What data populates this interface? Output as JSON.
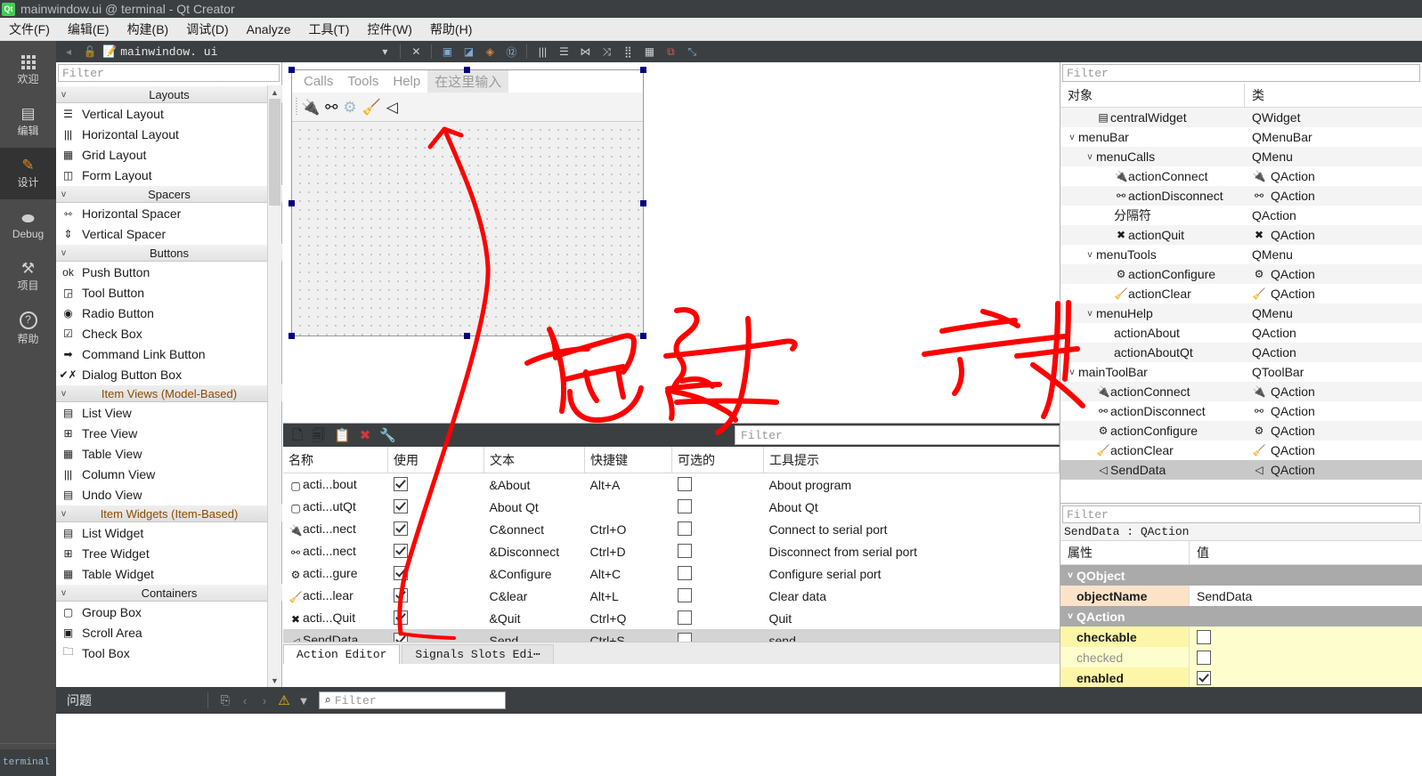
{
  "window": {
    "title": "mainwindow.ui @ terminal - Qt Creator",
    "logo": "qt-logo"
  },
  "menubar": {
    "items": [
      {
        "label": "文件(F)"
      },
      {
        "label": "编辑(E)"
      },
      {
        "label": "构建(B)"
      },
      {
        "label": "调试(D)"
      },
      {
        "label": "Analyze"
      },
      {
        "label": "工具(T)"
      },
      {
        "label": "控件(W)"
      },
      {
        "label": "帮助(H)"
      }
    ]
  },
  "modebar": {
    "items": [
      {
        "label": "欢迎",
        "icon": "grid-icon",
        "glyph": "",
        "active": false
      },
      {
        "label": "编辑",
        "icon": "document-icon",
        "glyph": "▤",
        "active": false
      },
      {
        "label": "设计",
        "icon": "pencil-icon",
        "glyph": "✎",
        "active": true
      },
      {
        "label": "Debug",
        "icon": "bug-icon",
        "glyph": "🐞",
        "active": false
      },
      {
        "label": "项目",
        "icon": "wrench-icon",
        "glyph": "🔧",
        "active": false
      },
      {
        "label": "帮助",
        "icon": "question-icon",
        "glyph": "?",
        "active": false
      }
    ],
    "taskbar_label": "terminal"
  },
  "editor_toolbar": {
    "filename": "mainwindow. ui",
    "lock_icon": "unlocked-padlock-icon",
    "file_icon": "ui-file-icon",
    "dropdown_icon": "chevron-down-icon",
    "close_icon": "close-icon",
    "buttons": [
      {
        "name": "adjust-size-button",
        "glyph": "▣"
      },
      {
        "name": "lay-out-break-button",
        "glyph": "◩"
      },
      {
        "name": "edit-signals-slots-button",
        "glyph": "◈"
      },
      {
        "name": "edit-tab-order-button",
        "glyph": "⑫"
      },
      {
        "name": "layout-horizontally-button",
        "glyph": "|||"
      },
      {
        "name": "layout-vertically-button",
        "glyph": "☰"
      },
      {
        "name": "layout-horizontal-splitter-button",
        "glyph": "⊦⊣"
      },
      {
        "name": "layout-vertical-splitter-button",
        "glyph": "⊼"
      },
      {
        "name": "layout-form-button",
        "glyph": "⠿"
      },
      {
        "name": "layout-grid-button",
        "glyph": "▦"
      },
      {
        "name": "break-layout-button",
        "glyph": "⧉"
      },
      {
        "name": "adjust-size-2-button",
        "glyph": "⤡"
      }
    ]
  },
  "widget_box": {
    "filter_placeholder": "Filter",
    "groups": [
      {
        "name": "Layouts",
        "selected": false,
        "items": [
          {
            "label": "Vertical Layout",
            "icon": "vertical-layout-icon",
            "glyph": "☰"
          },
          {
            "label": "Horizontal Layout",
            "icon": "horizontal-layout-icon",
            "glyph": "|||"
          },
          {
            "label": "Grid Layout",
            "icon": "grid-layout-icon",
            "glyph": "▦"
          },
          {
            "label": "Form Layout",
            "icon": "form-layout-icon",
            "glyph": "◫"
          }
        ]
      },
      {
        "name": "Spacers",
        "selected": false,
        "items": [
          {
            "label": "Horizontal Spacer",
            "icon": "horizontal-spacer-icon",
            "glyph": "⇿"
          },
          {
            "label": "Vertical Spacer",
            "icon": "vertical-spacer-icon",
            "glyph": "⇕"
          }
        ]
      },
      {
        "name": "Buttons",
        "selected": false,
        "items": [
          {
            "label": "Push Button",
            "icon": "push-button-icon",
            "glyph": "ok"
          },
          {
            "label": "Tool Button",
            "icon": "tool-button-icon",
            "glyph": "◲"
          },
          {
            "label": "Radio Button",
            "icon": "radio-button-icon",
            "glyph": "◉"
          },
          {
            "label": "Check Box",
            "icon": "check-box-icon",
            "glyph": "☑"
          },
          {
            "label": "Command Link Button",
            "icon": "command-link-button-icon",
            "glyph": "➡"
          },
          {
            "label": "Dialog Button Box",
            "icon": "dialog-button-box-icon",
            "glyph": "✔✗"
          }
        ]
      },
      {
        "name": "Item Views (Model-Based)",
        "selected": true,
        "items": [
          {
            "label": "List View",
            "icon": "list-view-icon",
            "glyph": "▤"
          },
          {
            "label": "Tree View",
            "icon": "tree-view-icon",
            "glyph": "⊞"
          },
          {
            "label": "Table View",
            "icon": "table-view-icon",
            "glyph": "▦"
          },
          {
            "label": "Column View",
            "icon": "column-view-icon",
            "glyph": "|||"
          },
          {
            "label": "Undo View",
            "icon": "undo-view-icon",
            "glyph": "▤"
          }
        ]
      },
      {
        "name": "Item Widgets (Item-Based)",
        "selected": true,
        "items": [
          {
            "label": "List Widget",
            "icon": "list-widget-icon",
            "glyph": "▤"
          },
          {
            "label": "Tree Widget",
            "icon": "tree-widget-icon",
            "glyph": "⊞"
          },
          {
            "label": "Table Widget",
            "icon": "table-widget-icon",
            "glyph": "▦"
          }
        ]
      },
      {
        "name": "Containers",
        "selected": false,
        "items": [
          {
            "label": "Group Box",
            "icon": "group-box-icon",
            "glyph": "▢"
          },
          {
            "label": "Scroll Area",
            "icon": "scroll-area-icon",
            "glyph": "▣"
          },
          {
            "label": "Tool Box",
            "icon": "tool-box-icon",
            "glyph": "🗀"
          }
        ]
      }
    ]
  },
  "form": {
    "menu_items": [
      "Calls",
      "Tools",
      "Help"
    ],
    "type_here": "在这里输入",
    "toolbar_icons": [
      {
        "name": "connect-icon",
        "glyph": "🔌"
      },
      {
        "name": "disconnect-icon",
        "glyph": "🔌"
      },
      {
        "name": "configure-gear-icon",
        "glyph": "⚙"
      },
      {
        "name": "clear-broom-icon",
        "glyph": "🧹"
      },
      {
        "name": "send-paperplane-icon",
        "glyph": "➤"
      }
    ]
  },
  "action_editor": {
    "toolbar_icons": [
      {
        "name": "new-action-icon",
        "glyph": "🗋"
      },
      {
        "name": "copy-action-icon",
        "glyph": "🗐"
      },
      {
        "name": "paste-action-icon",
        "glyph": "📋"
      },
      {
        "name": "delete-action-icon",
        "glyph": "✖"
      },
      {
        "name": "configure-action-icon",
        "glyph": "🔧"
      }
    ],
    "filter_placeholder": "Filter",
    "columns": [
      "名称",
      "使用",
      "文本",
      "快捷键",
      "可选的",
      "工具提示"
    ],
    "rows": [
      {
        "icon": "blank-icon",
        "name": "acti...bout",
        "used": true,
        "text": "&About",
        "shortcut": "Alt+A",
        "checkable": false,
        "tooltip": "About program",
        "selected": false
      },
      {
        "icon": "blank-icon",
        "name": "acti...utQt",
        "used": true,
        "text": "About Qt",
        "shortcut": "",
        "checkable": false,
        "tooltip": "About Qt",
        "selected": false
      },
      {
        "icon": "connect-icon",
        "name": "acti...nect",
        "used": true,
        "text": "C&onnect",
        "shortcut": "Ctrl+O",
        "checkable": false,
        "tooltip": "Connect to serial port",
        "selected": false
      },
      {
        "icon": "disconnect-icon",
        "name": "acti...nect",
        "used": true,
        "text": "&Disconnect",
        "shortcut": "Ctrl+D",
        "checkable": false,
        "tooltip": "Disconnect from serial port",
        "selected": false
      },
      {
        "icon": "configure-gear-icon",
        "name": "acti...gure",
        "used": true,
        "text": "&Configure",
        "shortcut": "Alt+C",
        "checkable": false,
        "tooltip": "Configure serial port",
        "selected": false
      },
      {
        "icon": "clear-broom-icon",
        "name": "acti...lear",
        "used": true,
        "text": "C&lear",
        "shortcut": "Alt+L",
        "checkable": false,
        "tooltip": "Clear data",
        "selected": false
      },
      {
        "icon": "quit-icon",
        "name": "acti...Quit",
        "used": true,
        "text": "&Quit",
        "shortcut": "Ctrl+Q",
        "checkable": false,
        "tooltip": "Quit",
        "selected": false
      },
      {
        "icon": "send-paperplane-icon",
        "name": "SendData",
        "used": true,
        "text": "Send",
        "shortcut": "Ctrl+S",
        "checkable": false,
        "tooltip": "send",
        "selected": true
      }
    ],
    "tabs": [
      {
        "label": "Action Editor",
        "active": true
      },
      {
        "label": "Signals  Slots Edi⋯",
        "active": false
      }
    ]
  },
  "object_inspector": {
    "filter_placeholder": "Filter",
    "columns": [
      "对象",
      "类"
    ],
    "rows": [
      {
        "object": "centralWidget",
        "class": "QWidget",
        "indent": 2,
        "chevron": "",
        "icon": "widget-icon",
        "selected": false,
        "alt": true
      },
      {
        "object": "menuBar",
        "class": "QMenuBar",
        "indent": 1,
        "chevron": "v",
        "icon": "",
        "selected": false,
        "alt": false
      },
      {
        "object": "menuCalls",
        "class": "QMenu",
        "indent": 2,
        "chevron": "v",
        "icon": "",
        "selected": false,
        "alt": true
      },
      {
        "object": "actionConnect",
        "class": "QAction",
        "indent": 3,
        "chevron": "",
        "icon": "connect-icon",
        "selected": false,
        "alt": false
      },
      {
        "object": "actionDisconnect",
        "class": "QAction",
        "indent": 3,
        "chevron": "",
        "icon": "disconnect-icon",
        "selected": false,
        "alt": true
      },
      {
        "object": "分隔符",
        "class": "QAction",
        "indent": 3,
        "chevron": "",
        "icon": "",
        "selected": false,
        "alt": false
      },
      {
        "object": "actionQuit",
        "class": "QAction",
        "indent": 3,
        "chevron": "",
        "icon": "quit-icon",
        "selected": false,
        "alt": true
      },
      {
        "object": "menuTools",
        "class": "QMenu",
        "indent": 2,
        "chevron": "v",
        "icon": "",
        "selected": false,
        "alt": false
      },
      {
        "object": "actionConfigure",
        "class": "QAction",
        "indent": 3,
        "chevron": "",
        "icon": "configure-gear-icon",
        "selected": false,
        "alt": true
      },
      {
        "object": "actionClear",
        "class": "QAction",
        "indent": 3,
        "chevron": "",
        "icon": "clear-broom-icon",
        "selected": false,
        "alt": false
      },
      {
        "object": "menuHelp",
        "class": "QMenu",
        "indent": 2,
        "chevron": "v",
        "icon": "",
        "selected": false,
        "alt": true
      },
      {
        "object": "actionAbout",
        "class": "QAction",
        "indent": 3,
        "chevron": "",
        "icon": "",
        "selected": false,
        "alt": false
      },
      {
        "object": "actionAboutQt",
        "class": "QAction",
        "indent": 3,
        "chevron": "",
        "icon": "",
        "selected": false,
        "alt": true
      },
      {
        "object": "mainToolBar",
        "class": "QToolBar",
        "indent": 1,
        "chevron": "v",
        "icon": "",
        "selected": false,
        "alt": false
      },
      {
        "object": "actionConnect",
        "class": "QAction",
        "indent": 2,
        "chevron": "",
        "icon": "connect-icon",
        "selected": false,
        "alt": true
      },
      {
        "object": "actionDisconnect",
        "class": "QAction",
        "indent": 2,
        "chevron": "",
        "icon": "disconnect-icon",
        "selected": false,
        "alt": false
      },
      {
        "object": "actionConfigure",
        "class": "QAction",
        "indent": 2,
        "chevron": "",
        "icon": "configure-gear-icon",
        "selected": false,
        "alt": true
      },
      {
        "object": "actionClear",
        "class": "QAction",
        "indent": 2,
        "chevron": "",
        "icon": "clear-broom-icon",
        "selected": false,
        "alt": false
      },
      {
        "object": "SendData",
        "class": "QAction",
        "indent": 2,
        "chevron": "",
        "icon": "send-paperplane-icon",
        "selected": true,
        "alt": false
      }
    ]
  },
  "property_editor": {
    "filter_placeholder": "Filter",
    "subject": "SendData : QAction",
    "columns": [
      "属性",
      "值"
    ],
    "groups": [
      {
        "name": "QObject",
        "rows": [
          {
            "property": "objectName",
            "value": "SendData",
            "type": "text",
            "style": "modified"
          }
        ]
      },
      {
        "name": "QAction",
        "rows": [
          {
            "property": "checkable",
            "value": "",
            "type": "checkbox",
            "checked": false,
            "style": "yellow"
          },
          {
            "property": "checked",
            "value": "",
            "type": "checkbox",
            "checked": false,
            "style": "yellow-dim"
          },
          {
            "property": "enabled",
            "value": "",
            "type": "checkbox",
            "checked": true,
            "style": "yellow"
          }
        ]
      }
    ]
  },
  "issues_bar": {
    "title": "问题",
    "filter_placeholder": "Filter",
    "icons": [
      {
        "name": "copy-issues-icon",
        "glyph": "⎘"
      },
      {
        "name": "prev-issue-icon",
        "glyph": "‹"
      },
      {
        "name": "next-issue-icon",
        "glyph": "›"
      },
      {
        "name": "warning-icon",
        "glyph": "⚠"
      },
      {
        "name": "filter-funnel-icon",
        "glyph": "▼"
      },
      {
        "name": "search-icon",
        "glyph": "⌕"
      }
    ]
  },
  "annotation": {
    "color": "#ff0000",
    "text": "拖过来"
  }
}
